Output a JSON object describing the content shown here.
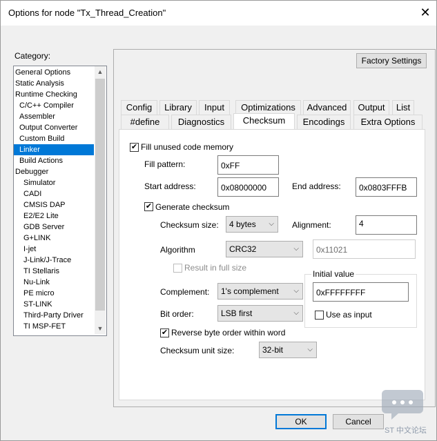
{
  "window": {
    "title": "Options for node \"Tx_Thread_Creation\""
  },
  "category": {
    "label": "Category:",
    "items": [
      "General Options",
      "Static Analysis",
      "Runtime Checking",
      "C/C++ Compiler",
      "Assembler",
      "Output Converter",
      "Custom Build",
      "Linker",
      "Build Actions",
      "Debugger",
      "Simulator",
      "CADI",
      "CMSIS DAP",
      "E2/E2 Lite",
      "GDB Server",
      "G+LINK",
      "I-jet",
      "J-Link/J-Trace",
      "TI Stellaris",
      "Nu-Link",
      "PE micro",
      "ST-LINK",
      "Third-Party Driver",
      "TI MSP-FET"
    ],
    "selected": "Linker"
  },
  "factory_settings": "Factory Settings",
  "tabs_row1": [
    "Config",
    "Library",
    "Input",
    "Optimizations",
    "Advanced",
    "Output",
    "List"
  ],
  "tabs_row2": [
    "#define",
    "Diagnostics",
    "Checksum",
    "Encodings",
    "Extra Options"
  ],
  "active_tab": "Checksum",
  "fill": {
    "checkbox_label": "Fill unused code memory",
    "checked": true,
    "pattern_label": "Fill pattern:",
    "pattern_value": "0xFF",
    "start_label": "Start address:",
    "start_value": "0x08000000",
    "end_label": "End address:",
    "end_value": "0x0803FFFB"
  },
  "checksum": {
    "generate_label": "Generate checksum",
    "generate_checked": true,
    "size_label": "Checksum size:",
    "size_value": "4 bytes",
    "alignment_label": "Alignment:",
    "alignment_value": "4",
    "algorithm_label": "Algorithm",
    "algorithm_value": "CRC32",
    "poly_value": "0x11021",
    "result_full_label": "Result in full size",
    "result_full_checked": false,
    "complement_label": "Complement:",
    "complement_value": "1's complement",
    "bit_order_label": "Bit order:",
    "bit_order_value": "LSB first",
    "initial_value_label": "Initial value",
    "initial_value": "0xFFFFFFFF",
    "use_as_input_label": "Use as input",
    "use_as_input_checked": false,
    "reverse_label": "Reverse byte order within word",
    "reverse_checked": true,
    "unit_size_label": "Checksum unit size:",
    "unit_size_value": "32-bit"
  },
  "buttons": {
    "ok": "OK",
    "cancel": "Cancel"
  },
  "watermark": {
    "text": "ST 中文论坛"
  },
  "colors": {
    "selection": "#0078d7",
    "accent_border": "#0078d7"
  }
}
